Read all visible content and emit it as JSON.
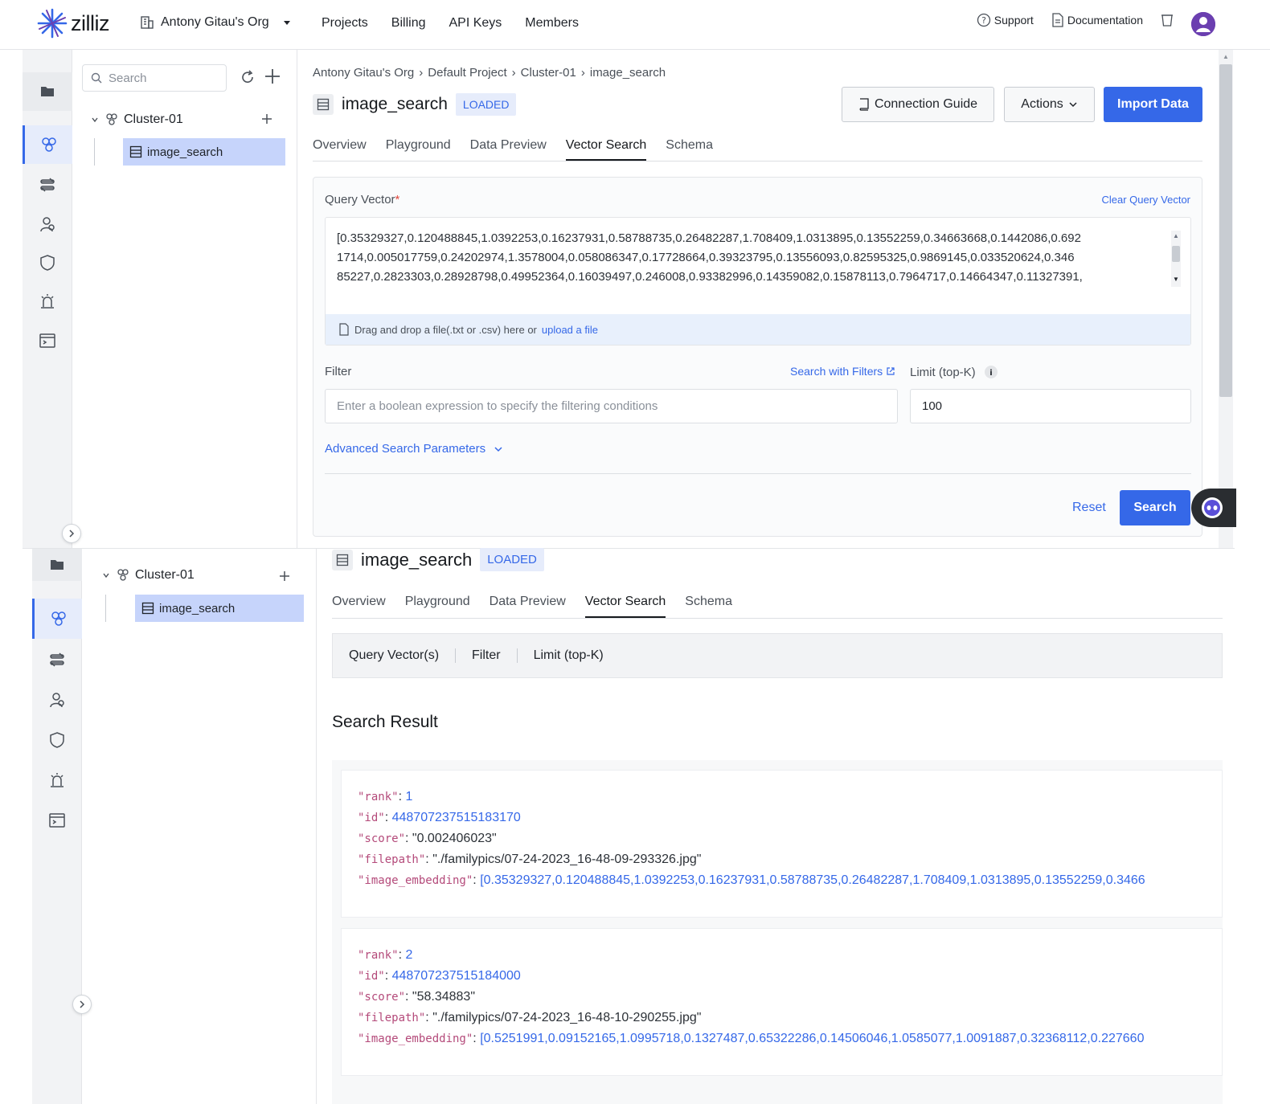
{
  "app": {
    "brand": "zilliz",
    "org": "Antony Gitau's Org",
    "nav": [
      "Projects",
      "Billing",
      "API Keys",
      "Members"
    ],
    "support": "Support",
    "documentation": "Documentation"
  },
  "sidebar": {
    "search_placeholder": "Search",
    "cluster": "Cluster-01",
    "collection": "image_search"
  },
  "breadcrumb": [
    "Antony Gitau's Org",
    "Default Project",
    "Cluster-01",
    "image_search"
  ],
  "collection": {
    "name": "image_search",
    "status": "LOADED"
  },
  "actions": {
    "connection_guide": "Connection Guide",
    "actions": "Actions",
    "import_data": "Import Data"
  },
  "tabs": [
    "Overview",
    "Playground",
    "Data Preview",
    "Vector Search",
    "Schema"
  ],
  "vector_search": {
    "query_vector_label": "Query Vector",
    "required_mark": "*",
    "clear_label": "Clear Query Vector",
    "vector_lines": [
      "[0.35329327,0.120488845,1.0392253,0.16237931,0.58788735,0.26482287,1.708409,1.0313895,0.13552259,0.34663668,0.1442086,0.692",
      "1714,0.005017759,0.24202974,1.3578004,0.058086347,0.17728664,0.39323795,0.13556093,0.82595325,0.9869145,0.033520624,0.346",
      "85227,0.2823303,0.28928798,0.49952364,0.16039497,0.246008,0.93382996,0.14359082,0.15878113,0.7964717,0.14664347,0.11327391,"
    ],
    "dropzone_text": "Drag and drop a file(.txt or .csv) here or",
    "dropzone_link": "upload a file",
    "filter_label": "Filter",
    "filter_link": "Search with Filters",
    "filter_placeholder": "Enter a boolean expression to specify the filtering conditions",
    "limit_label": "Limit (top-K)",
    "limit_value": "100",
    "advanced": "Advanced Search Parameters",
    "reset": "Reset",
    "search": "Search"
  },
  "summary": [
    "Query Vector(s)",
    "Filter",
    "Limit (top-K)"
  ],
  "result_title": "Search Result",
  "results": [
    {
      "rank": "1",
      "id": "448707237515183170",
      "score": "\"0.002406023\"",
      "filepath": "\"./familypics/07-24-2023_16-48-09-293326.jpg\"",
      "image_embedding": "[0.35329327,0.120488845,1.0392253,0.16237931,0.58788735,0.26482287,1.708409,1.0313895,0.13552259,0.3466"
    },
    {
      "rank": "2",
      "id": "448707237515184000",
      "score": "\"58.34883\"",
      "filepath": "\"./familypics/07-24-2023_16-48-10-290255.jpg\"",
      "image_embedding": "[0.5251991,0.09152165,1.0995718,0.1327487,0.65322286,0.14506046,1.0585077,1.0091887,0.32368112,0.227660"
    }
  ],
  "json_keys": {
    "rank": "\"rank\"",
    "id": "\"id\"",
    "score": "\"score\"",
    "filepath": "\"filepath\"",
    "image_embedding": "\"image_embedding\""
  },
  "colors": {
    "accent": "#3568e8",
    "selected": "#c6d4fb",
    "json_key": "#b44a7a"
  }
}
